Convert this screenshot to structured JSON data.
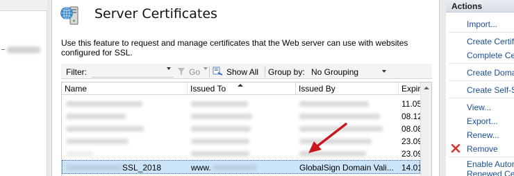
{
  "main": {
    "title": "Server Certificates",
    "description": "Use this feature to request and manage certificates that the Web server can use with websites configured for SSL."
  },
  "toolbar": {
    "filter_label": "Filter:",
    "go_label": "Go",
    "show_all_label": "Show All",
    "group_by_label": "Group by:",
    "group_by_value": "No Grouping"
  },
  "grid": {
    "columns": [
      "Name",
      "Issued To",
      "Issued By",
      "Expir"
    ],
    "rows": [
      {
        "name": "",
        "issued_to": "",
        "issued_by": "",
        "expiration": "11.05"
      },
      {
        "name": "",
        "issued_to": "",
        "issued_by": "",
        "expiration": "08.12"
      },
      {
        "name": "",
        "issued_to": "",
        "issued_by": "",
        "expiration": "08.08"
      },
      {
        "name": "",
        "issued_to": "",
        "issued_by": "",
        "expiration": "23.09"
      },
      {
        "name": "",
        "issued_to": "",
        "issued_by": "",
        "expiration": "23.09"
      },
      {
        "name": "SSL_2018",
        "issued_to": "www.",
        "issued_by": "GlobalSign Domain Vali...",
        "expiration": "14.01"
      }
    ],
    "selected_row_index": 5
  },
  "actions": {
    "title": "Actions",
    "items": [
      {
        "label": "Import..."
      },
      {
        "label": "Create Certifi"
      },
      {
        "label": "Complete Cer"
      },
      {
        "label": "Create Doma"
      },
      {
        "label": "Create Self-S"
      },
      {
        "label": "View..."
      },
      {
        "label": "Export..."
      },
      {
        "label": "Renew..."
      },
      {
        "label": "Remove"
      },
      {
        "label": "Enable Autor"
      },
      {
        "label": "Renewed Cer"
      }
    ]
  },
  "colors": {
    "link": "#1a4d96",
    "selection": "#cce4f7",
    "annotation_arrow": "#c8171f",
    "remove_icon": "#d6312b"
  },
  "icons": [
    "server-certificates-icon",
    "go-icon",
    "show-all-icon",
    "remove-icon",
    "sort-ascending-icon",
    "annotation-arrow"
  ]
}
